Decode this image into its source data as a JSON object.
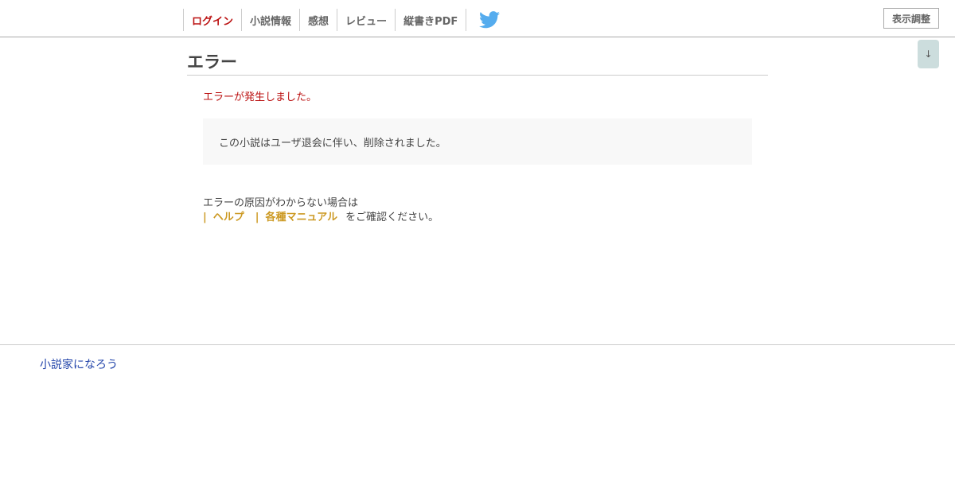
{
  "header": {
    "nav": [
      {
        "label": "ログイン"
      },
      {
        "label": "小説情報"
      },
      {
        "label": "感想"
      },
      {
        "label": "レビュー"
      },
      {
        "label": "縦書きPDF"
      }
    ],
    "display_settings_label": "表示調整",
    "scroll_label": "↓"
  },
  "main": {
    "title": "エラー",
    "error_message": "エラーが発生しました。",
    "error_detail": "この小説はユーザ退会に伴い、削除されました。",
    "help_intro": "エラーの原因がわからない場合は",
    "help_links": [
      {
        "label": "ヘルプ"
      },
      {
        "label": "各種マニュアル"
      }
    ],
    "help_tail": "をご確認ください。"
  },
  "footer": {
    "site_link": "小説家になろう"
  },
  "colors": {
    "accent_red": "#bb1111",
    "link_gold": "#cc9922",
    "footer_link_blue": "#2244aa",
    "twitter_blue": "#55acee"
  },
  "icons": {
    "twitter": "twitter-bird-icon"
  }
}
